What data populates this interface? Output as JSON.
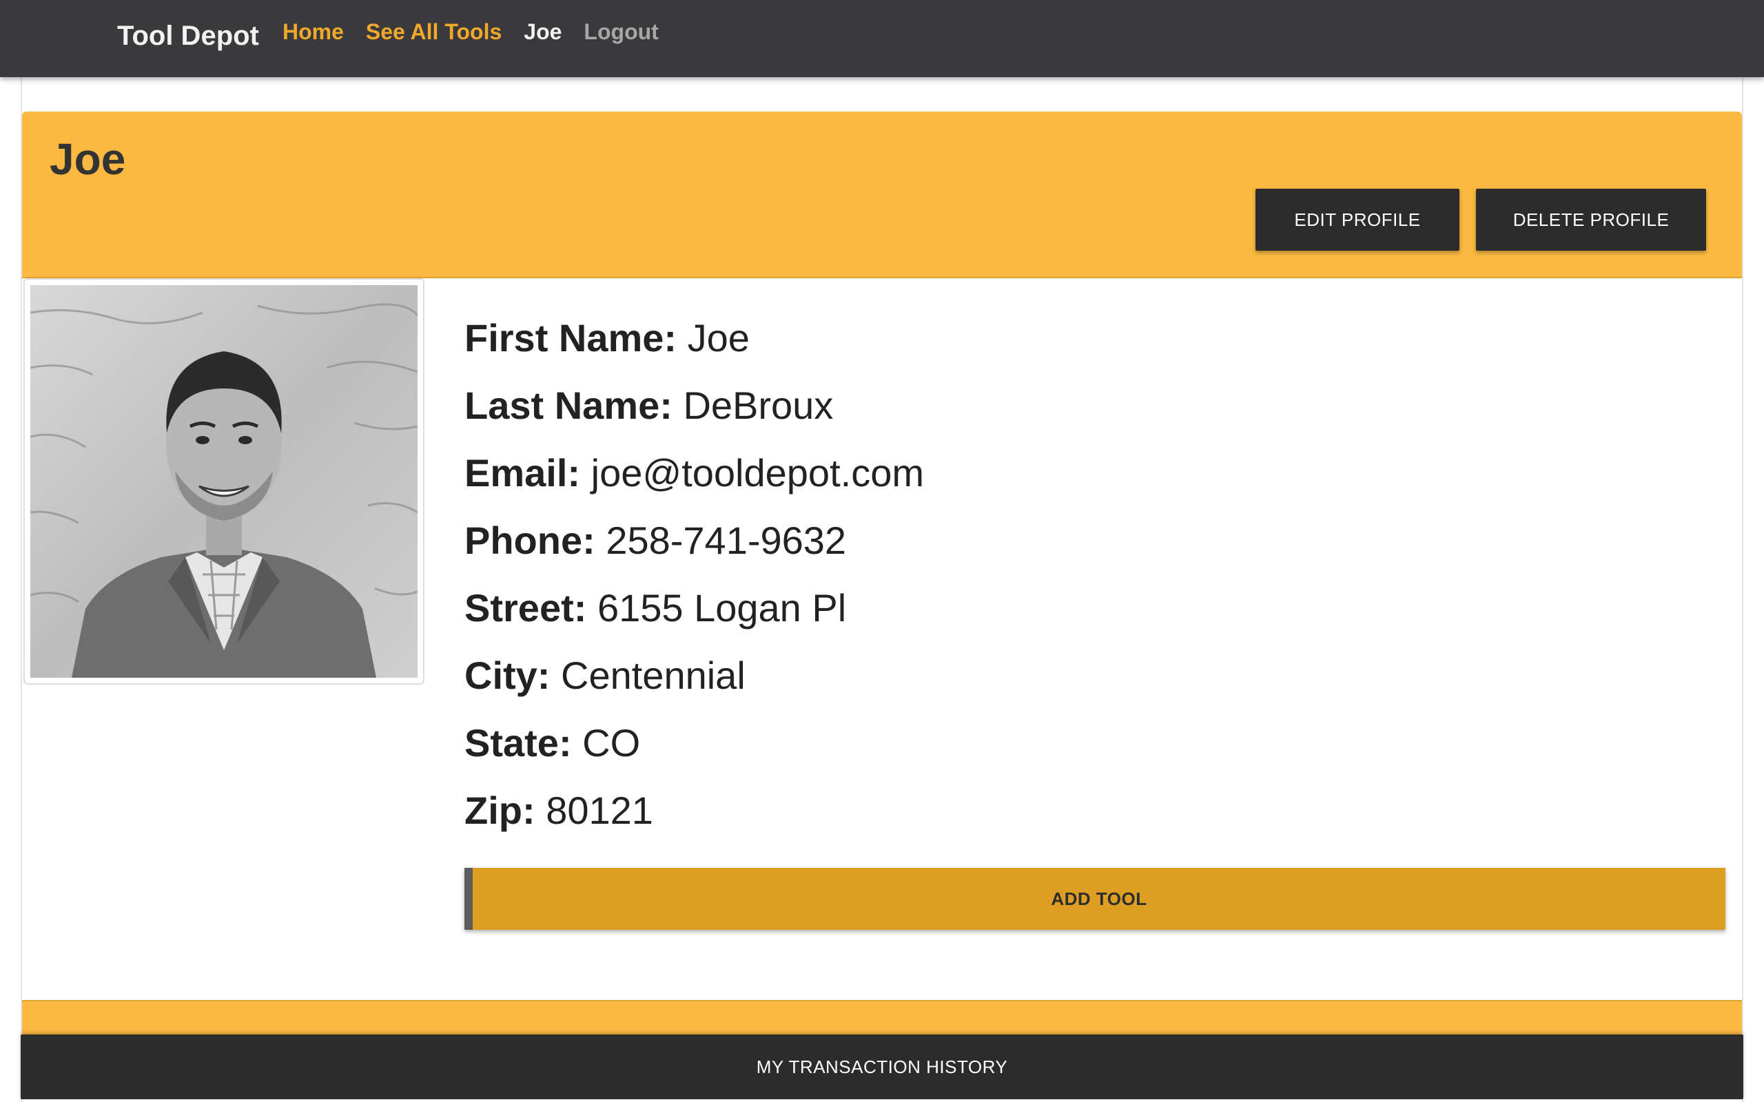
{
  "navbar": {
    "brand": "Tool Depot",
    "links": {
      "home": "Home",
      "see_all_tools": "See All Tools",
      "user": "Joe",
      "logout": "Logout"
    }
  },
  "profile": {
    "title": "Joe",
    "buttons": {
      "edit": "EDIT PROFILE",
      "delete": "DELETE PROFILE"
    },
    "photo_icon": "user-photo",
    "fields": [
      {
        "label": "First Name:",
        "value": "Joe"
      },
      {
        "label": "Last Name:",
        "value": "DeBroux"
      },
      {
        "label": "Email:",
        "value": "joe@tooldepot.com"
      },
      {
        "label": "Phone:",
        "value": "258-741-9632"
      },
      {
        "label": "Street:",
        "value": "6155 Logan Pl"
      },
      {
        "label": "City:",
        "value": "Centennial"
      },
      {
        "label": "State:",
        "value": "CO"
      },
      {
        "label": "Zip:",
        "value": "80121"
      }
    ],
    "add_tool": "ADD TOOL",
    "transaction_history": "MY TRANSACTION HISTORY"
  },
  "colors": {
    "navbar_bg": "#3a393b",
    "accent_yellow": "#fbb941",
    "add_tool_bg": "#de9e22",
    "dark_button": "#2c2c2d",
    "nav_link_active": "#f0a92a"
  }
}
